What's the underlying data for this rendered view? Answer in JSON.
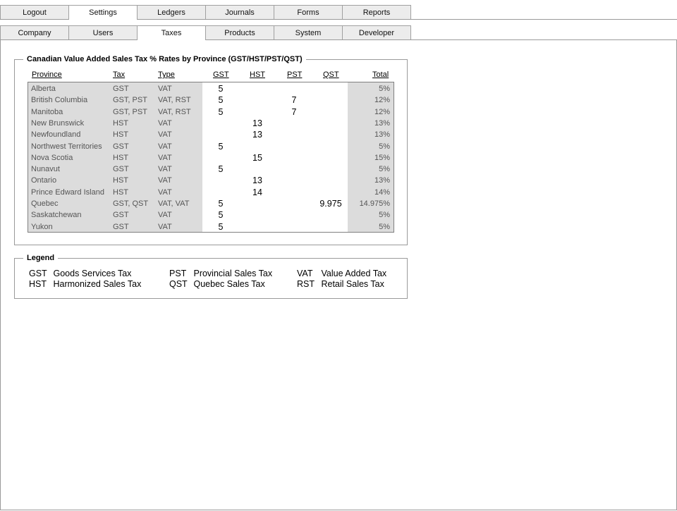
{
  "tabs_main": [
    {
      "label": "Logout",
      "active": false
    },
    {
      "label": "Settings",
      "active": true
    },
    {
      "label": "Ledgers",
      "active": false
    },
    {
      "label": "Journals",
      "active": false
    },
    {
      "label": "Forms",
      "active": false
    },
    {
      "label": "Reports",
      "active": false
    }
  ],
  "tabs_sub": [
    {
      "label": "Company",
      "active": false
    },
    {
      "label": "Users",
      "active": false
    },
    {
      "label": "Taxes",
      "active": true
    },
    {
      "label": "Products",
      "active": false
    },
    {
      "label": "System",
      "active": false
    },
    {
      "label": "Developer",
      "active": false
    }
  ],
  "tax_table": {
    "title": "Canadian Value Added Sales Tax % Rates by Province (GST/HST/PST/QST)",
    "headers": {
      "province": "Province",
      "tax": "Tax",
      "type": "Type",
      "gst": "GST",
      "hst": "HST",
      "pst": "PST",
      "qst": "QST",
      "total": "Total"
    },
    "rows": [
      {
        "province": "Alberta",
        "tax": "GST",
        "type": "VAT",
        "gst": "5",
        "hst": "",
        "pst": "",
        "qst": "",
        "total": "5%"
      },
      {
        "province": "British Columbia",
        "tax": "GST, PST",
        "type": "VAT, RST",
        "gst": "5",
        "hst": "",
        "pst": "7",
        "qst": "",
        "total": "12%"
      },
      {
        "province": "Manitoba",
        "tax": "GST, PST",
        "type": "VAT, RST",
        "gst": "5",
        "hst": "",
        "pst": "7",
        "qst": "",
        "total": "12%"
      },
      {
        "province": "New Brunswick",
        "tax": "HST",
        "type": "VAT",
        "gst": "",
        "hst": "13",
        "pst": "",
        "qst": "",
        "total": "13%"
      },
      {
        "province": "Newfoundland",
        "tax": "HST",
        "type": "VAT",
        "gst": "",
        "hst": "13",
        "pst": "",
        "qst": "",
        "total": "13%"
      },
      {
        "province": "Northwest Territories",
        "tax": "GST",
        "type": "VAT",
        "gst": "5",
        "hst": "",
        "pst": "",
        "qst": "",
        "total": "5%"
      },
      {
        "province": "Nova Scotia",
        "tax": "HST",
        "type": "VAT",
        "gst": "",
        "hst": "15",
        "pst": "",
        "qst": "",
        "total": "15%"
      },
      {
        "province": "Nunavut",
        "tax": "GST",
        "type": "VAT",
        "gst": "5",
        "hst": "",
        "pst": "",
        "qst": "",
        "total": "5%"
      },
      {
        "province": "Ontario",
        "tax": "HST",
        "type": "VAT",
        "gst": "",
        "hst": "13",
        "pst": "",
        "qst": "",
        "total": "13%"
      },
      {
        "province": "Prince Edward Island",
        "tax": "HST",
        "type": "VAT",
        "gst": "",
        "hst": "14",
        "pst": "",
        "qst": "",
        "total": "14%"
      },
      {
        "province": "Quebec",
        "tax": "GST, QST",
        "type": "VAT, VAT",
        "gst": "5",
        "hst": "",
        "pst": "",
        "qst": "9.975",
        "total": "14.975%"
      },
      {
        "province": "Saskatchewan",
        "tax": "GST",
        "type": "VAT",
        "gst": "5",
        "hst": "",
        "pst": "",
        "qst": "",
        "total": "5%"
      },
      {
        "province": "Yukon",
        "tax": "GST",
        "type": "VAT",
        "gst": "5",
        "hst": "",
        "pst": "",
        "qst": "",
        "total": "5%"
      }
    ]
  },
  "legend": {
    "title": "Legend",
    "items": [
      {
        "abbr": "GST",
        "text": "Goods Services Tax"
      },
      {
        "abbr": "HST",
        "text": "Harmonized Sales Tax"
      },
      {
        "abbr": "PST",
        "text": "Provincial Sales Tax"
      },
      {
        "abbr": "QST",
        "text": "Quebec Sales Tax"
      },
      {
        "abbr": "VAT",
        "text": "Value Added Tax"
      },
      {
        "abbr": "RST",
        "text": "Retail Sales Tax"
      }
    ]
  }
}
